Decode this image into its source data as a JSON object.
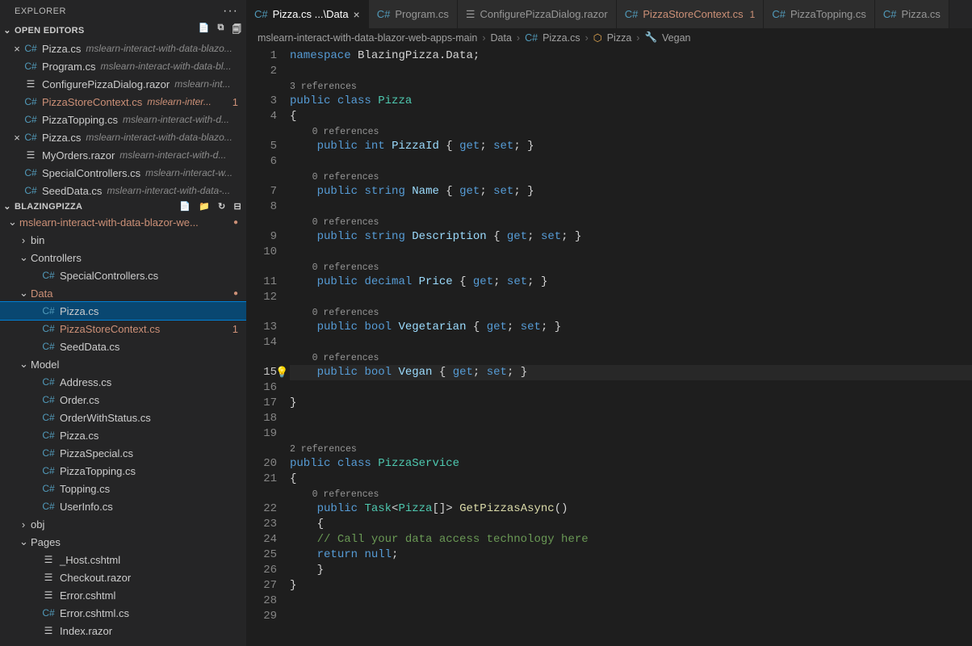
{
  "explorer": {
    "title": "EXPLORER"
  },
  "openEditors": {
    "title": "OPEN EDITORS",
    "items": [
      {
        "name": "Pizza.cs",
        "path": "mslearn-interact-with-data-blazo...",
        "close": true,
        "cs": true
      },
      {
        "name": "Program.cs",
        "path": "mslearn-interact-with-data-bl...",
        "cs": true
      },
      {
        "name": "ConfigurePizzaDialog.razor",
        "path": "mslearn-int...",
        "cs": false
      },
      {
        "name": "PizzaStoreContext.cs",
        "path": "mslearn-inter...",
        "cs": true,
        "modified": true,
        "badge": "1"
      },
      {
        "name": "PizzaTopping.cs",
        "path": "mslearn-interact-with-d...",
        "cs": true
      },
      {
        "name": "Pizza.cs",
        "path": "mslearn-interact-with-data-blazo...",
        "close": true,
        "cs": true
      },
      {
        "name": "MyOrders.razor",
        "path": "mslearn-interact-with-d...",
        "cs": false
      },
      {
        "name": "SpecialControllers.cs",
        "path": "mslearn-interact-w...",
        "cs": true
      },
      {
        "name": "SeedData.cs",
        "path": "mslearn-interact-with-data-...",
        "cs": true
      }
    ]
  },
  "workspace": {
    "name": "BLAZINGPIZZA",
    "root": {
      "label": "mslearn-interact-with-data-blazor-we...",
      "modified": true
    },
    "tree": [
      {
        "label": "bin",
        "type": "folder",
        "indent": 1
      },
      {
        "label": "Controllers",
        "type": "folderOpen",
        "indent": 1
      },
      {
        "label": "SpecialControllers.cs",
        "type": "cs",
        "indent": 2
      },
      {
        "label": "Data",
        "type": "folderOpen",
        "indent": 1,
        "modified": true,
        "dot": true
      },
      {
        "label": "Pizza.cs",
        "type": "cs",
        "indent": 2,
        "active": true
      },
      {
        "label": "PizzaStoreContext.cs",
        "type": "cs",
        "indent": 2,
        "modified": true,
        "badge": "1"
      },
      {
        "label": "SeedData.cs",
        "type": "cs",
        "indent": 2
      },
      {
        "label": "Model",
        "type": "folderOpen",
        "indent": 1
      },
      {
        "label": "Address.cs",
        "type": "cs",
        "indent": 2
      },
      {
        "label": "Order.cs",
        "type": "cs",
        "indent": 2
      },
      {
        "label": "OrderWithStatus.cs",
        "type": "cs",
        "indent": 2
      },
      {
        "label": "Pizza.cs",
        "type": "cs",
        "indent": 2
      },
      {
        "label": "PizzaSpecial.cs",
        "type": "cs",
        "indent": 2
      },
      {
        "label": "PizzaTopping.cs",
        "type": "cs",
        "indent": 2
      },
      {
        "label": "Topping.cs",
        "type": "cs",
        "indent": 2
      },
      {
        "label": "UserInfo.cs",
        "type": "cs",
        "indent": 2
      },
      {
        "label": "obj",
        "type": "folder",
        "indent": 1
      },
      {
        "label": "Pages",
        "type": "folderOpen",
        "indent": 1
      },
      {
        "label": "_Host.cshtml",
        "type": "razor",
        "indent": 2
      },
      {
        "label": "Checkout.razor",
        "type": "razor",
        "indent": 2
      },
      {
        "label": "Error.cshtml",
        "type": "razor",
        "indent": 2
      },
      {
        "label": "Error.cshtml.cs",
        "type": "cs",
        "indent": 2
      },
      {
        "label": "Index.razor",
        "type": "razor",
        "indent": 2
      }
    ]
  },
  "tabs": [
    {
      "label": "Pizza.cs ...\\Data",
      "cs": true,
      "active": true,
      "close": true
    },
    {
      "label": "Program.cs",
      "cs": true
    },
    {
      "label": "ConfigurePizzaDialog.razor",
      "cs": false
    },
    {
      "label": "PizzaStoreContext.cs",
      "cs": true,
      "modified": true,
      "badge": "1"
    },
    {
      "label": "PizzaTopping.cs",
      "cs": true
    },
    {
      "label": "Pizza.cs",
      "cs": true
    }
  ],
  "breadcrumb": {
    "parts": [
      "mslearn-interact-with-data-blazor-web-apps-main",
      "Data",
      "Pizza.cs",
      "Pizza",
      "Vegan"
    ]
  },
  "code": {
    "refs": {
      "r3": "3 references",
      "r0": "0 references",
      "r2": "2 references"
    },
    "namespace": "namespace",
    "nsname": "BlazingPizza.Data",
    "public": "public",
    "class": "class",
    "Pizza": "Pizza",
    "int": "int",
    "string": "string",
    "decimal": "decimal",
    "bool": "bool",
    "get": "get",
    "set": "set",
    "PizzaId": "PizzaId",
    "Name": "Name",
    "Description": "Description",
    "Price": "Price",
    "Vegetarian": "Vegetarian",
    "Vegan": "Vegan",
    "PizzaService": "PizzaService",
    "Task": "Task",
    "GetPizzasAsync": "GetPizzasAsync",
    "comment": "// Call your data access technology here",
    "return": "return",
    "null": "null"
  }
}
